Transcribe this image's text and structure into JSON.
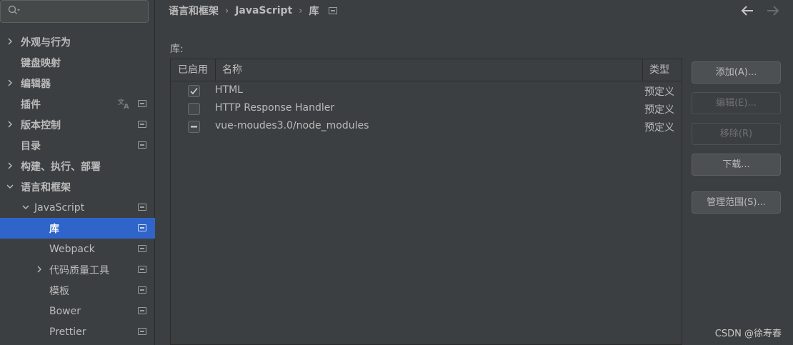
{
  "search": {
    "placeholder": ""
  },
  "sidebar": {
    "items": [
      {
        "label": "外观与行为"
      },
      {
        "label": "键盘映射"
      },
      {
        "label": "编辑器"
      },
      {
        "label": "插件"
      },
      {
        "label": "版本控制"
      },
      {
        "label": "目录"
      },
      {
        "label": "构建、执行、部署"
      },
      {
        "label": "语言和框架"
      },
      {
        "label": "JavaScript"
      },
      {
        "label": "库"
      },
      {
        "label": "Webpack"
      },
      {
        "label": "代码质量工具"
      },
      {
        "label": "模板"
      },
      {
        "label": "Bower"
      },
      {
        "label": "Prettier"
      }
    ]
  },
  "breadcrumb": {
    "part1": "语言和框架",
    "part2": "JavaScript",
    "part3": "库",
    "sep": "›"
  },
  "main": {
    "section_label": "库:",
    "table": {
      "headers": {
        "enabled": "已启用",
        "name": "名称",
        "type": "类型"
      },
      "rows": [
        {
          "name": "HTML",
          "type": "预定义",
          "state": "checked"
        },
        {
          "name": "HTTP Response Handler",
          "type": "预定义",
          "state": "unchecked"
        },
        {
          "name": "vue-moudes3.0/node_modules",
          "type": "预定义",
          "state": "indeterminate"
        }
      ]
    }
  },
  "buttons": {
    "add": "添加(A)...",
    "edit": "编辑(E)...",
    "remove": "移除(R)",
    "download": "下载...",
    "manage_scope": "管理范围(S)..."
  },
  "watermark": "CSDN @徐寿春",
  "colors": {
    "selection": "#2f65ca",
    "background": "#3c3f41",
    "text": "#bbbbbb"
  }
}
